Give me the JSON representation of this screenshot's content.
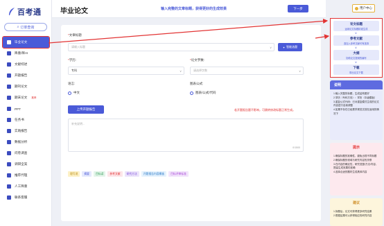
{
  "app": {
    "name": "百考通"
  },
  "sidebar": {
    "order_query": "订单查询",
    "items": [
      {
        "label": "毕业论文",
        "icon": "document-icon"
      },
      {
        "label": "降重/降AI",
        "icon": "reduce-icon"
      },
      {
        "label": "文献综述",
        "icon": "book-icon"
      },
      {
        "label": "开题报告",
        "icon": "report-icon"
      },
      {
        "label": "期刊论文",
        "icon": "journal-icon"
      },
      {
        "label": "期末论文",
        "icon": "exam-icon",
        "badge": "推荐"
      },
      {
        "label": "PPT",
        "icon": "ppt-icon"
      },
      {
        "label": "任务书",
        "icon": "task-icon"
      },
      {
        "label": "实践报告",
        "icon": "practice-icon"
      },
      {
        "label": "数据分析",
        "icon": "chart-icon"
      },
      {
        "label": "问卷调查",
        "icon": "survey-icon"
      },
      {
        "label": "调研全案",
        "icon": "research-icon"
      },
      {
        "label": "推荐代理",
        "icon": "agent-icon"
      },
      {
        "label": "人工降重",
        "icon": "person-icon"
      },
      {
        "label": "联系客服",
        "icon": "service-icon"
      }
    ]
  },
  "header": {
    "title": "毕业论文",
    "hint": "输入完整的文章标题，获得更好的生成效果",
    "next_label": "下一步",
    "account_label": "用户中心"
  },
  "form": {
    "title_label": "文章标题",
    "title_placeholder": "请输入标题",
    "smart_button": "智能选题",
    "degree_label": "学历:",
    "degree_value": "专科",
    "words_label": "论文字数:",
    "words_placeholder": "请选择字数",
    "lang_label": "语言:",
    "lang_value": "中文",
    "formula_label": "图表公式:",
    "formula_value": "图表/公式/代码",
    "upload_button": "上传开题报告",
    "red_note": "若开题报告题不影响，可跳转修改标题正常生成。",
    "textarea_placeholder": "补充说明...",
    "counter": "0/1500",
    "tags": [
      {
        "label": "理写说",
        "bg": "#fdf1c7",
        "fg": "#b88a10"
      },
      {
        "label": "摘要",
        "bg": "#e5e9fd",
        "fg": "#4a5ad8"
      },
      {
        "label": "目标读",
        "bg": "#e4f5ea",
        "fg": "#2e9a55"
      },
      {
        "label": "参考文献",
        "bg": "#fde6e9",
        "fg": "#e23333"
      },
      {
        "label": "研究方法",
        "bg": "#ece4fb",
        "fg": "#7a4bd8"
      },
      {
        "label": "开题报告内容模板",
        "bg": "#e5f2fd",
        "fg": "#2a7ac8"
      },
      {
        "label": "目标评审标准",
        "bg": "#f2e4fb",
        "fg": "#a94bd8"
      }
    ]
  },
  "steps": [
    {
      "title": "论文标题",
      "sub": "运用论文标题精准生成"
    },
    {
      "title": "参考文献",
      "sub": "选加入参考文献可有选择"
    },
    {
      "title": "大纲",
      "sub": "协助论文提纲的编写"
    },
    {
      "title": "下载",
      "sub": "带出论文下载"
    }
  ],
  "panels": {
    "explain": {
      "title": "说明",
      "text": "1.输入完整的标题，生成结构更好\n2.学历（专科方向）：学历（中级模板）\n3.重复公式代码：已对重复模式生成的论文内容进行自我调整\n4.如果不存在已经是学规范文档在适用的情况下"
    },
    "warning": {
      "title": "提示",
      "text": "1.确保标题的准确性，避免出现不同标题\n2.确保标题的领域与研究内容的关联\n3.在内容的确定性，研究范围/方法/内容，提高生成效果的准确\n4.选择合适的题材生成具体内容"
    },
    "suggest": {
      "title": "建议",
      "text": "1.拟题后，论文可获得更多研究结果\n2.根据结果可以获得相应的研究内容"
    }
  },
  "colors": {
    "accent": "#4a5ad8",
    "highlight": "#e23333"
  }
}
